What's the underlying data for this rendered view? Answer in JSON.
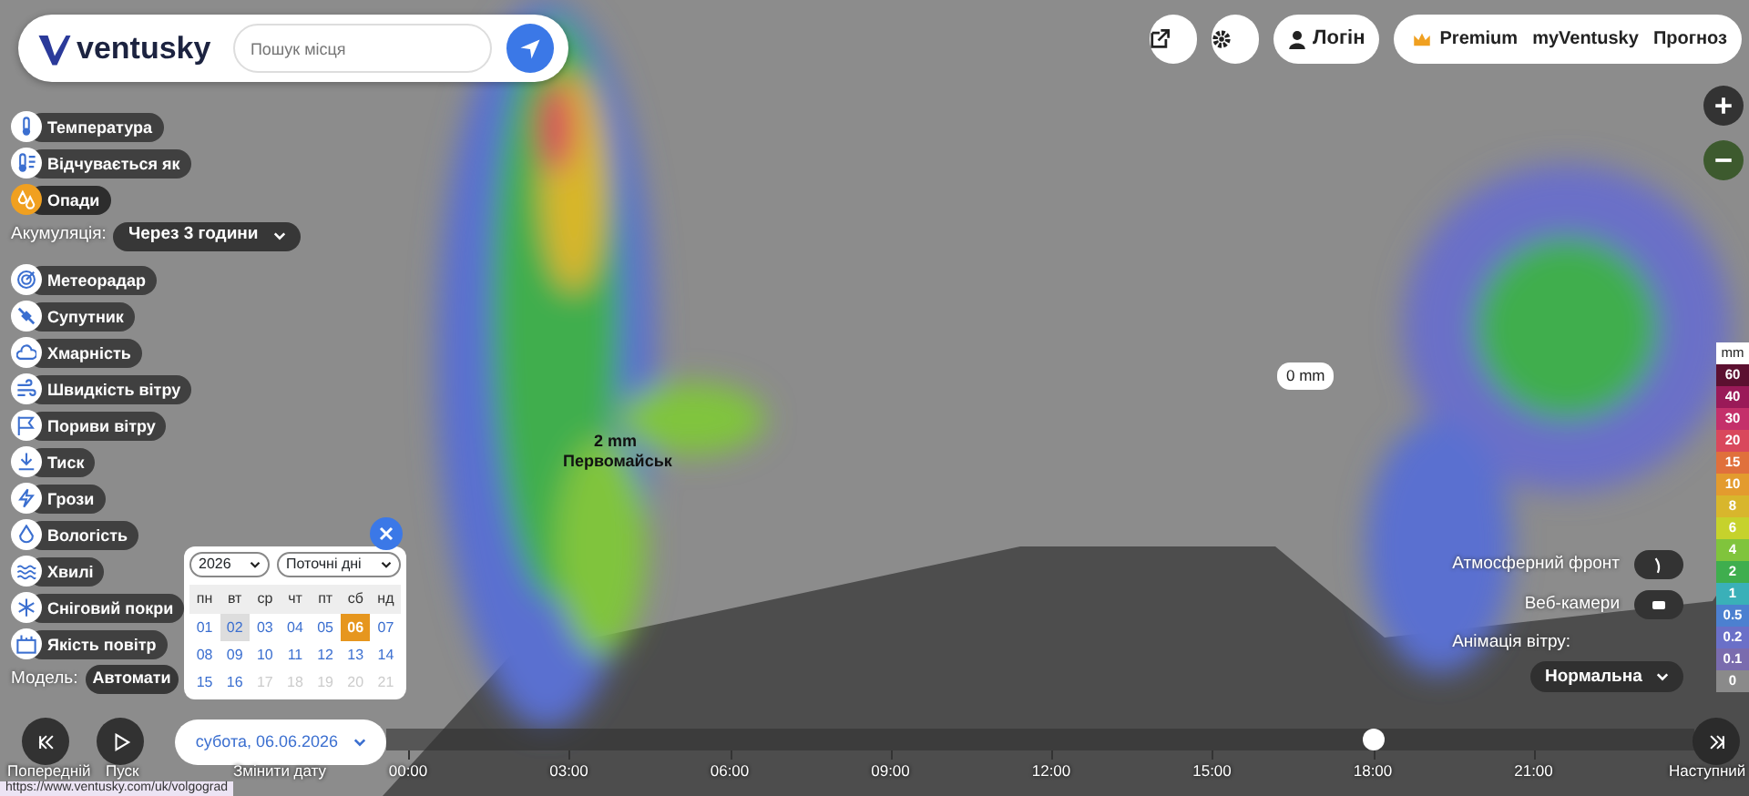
{
  "header": {
    "logo": "ventusky",
    "search": {
      "placeholder": "Пошук місця"
    }
  },
  "top_buttons": {
    "login": "Логін",
    "premium": "Premium",
    "my": "myVentusky",
    "forecast": "Прогноз"
  },
  "layers": [
    {
      "label": "Температура",
      "selected": false
    },
    {
      "label": "Відчувається як",
      "selected": false
    },
    {
      "label": "Опади",
      "selected": true
    },
    {
      "label": "Метеорадар",
      "selected": false
    },
    {
      "label": "Супутник",
      "selected": false
    },
    {
      "label": "Хмарність",
      "selected": false
    },
    {
      "label": "Швидкість вітру",
      "selected": false
    },
    {
      "label": "Пориви вітру",
      "selected": false
    },
    {
      "label": "Тиск",
      "selected": false
    },
    {
      "label": "Грози",
      "selected": false
    },
    {
      "label": "Вологість",
      "selected": false
    },
    {
      "label": "Хвилі",
      "selected": false
    },
    {
      "label": "Сніговий покри",
      "selected": false
    },
    {
      "label": "Якість повітр",
      "selected": false
    }
  ],
  "accumulation": {
    "label": "Акумуляція:",
    "value": "Через 3 години"
  },
  "model": {
    "label": "Модель:",
    "value": "Автомати"
  },
  "calendar": {
    "year": "2026",
    "range": "Поточні дні",
    "weekdays": [
      "пн",
      "вт",
      "ср",
      "чт",
      "пт",
      "сб",
      "нд"
    ],
    "days": [
      {
        "label": "01",
        "selected": false,
        "today": false,
        "disabled": false
      },
      {
        "label": "02",
        "selected": false,
        "today": true,
        "disabled": false
      },
      {
        "label": "03",
        "selected": false,
        "today": false,
        "disabled": false
      },
      {
        "label": "04",
        "selected": false,
        "today": false,
        "disabled": false
      },
      {
        "label": "05",
        "selected": false,
        "today": false,
        "disabled": false
      },
      {
        "label": "06",
        "selected": true,
        "today": false,
        "disabled": false
      },
      {
        "label": "07",
        "selected": false,
        "today": false,
        "disabled": false
      },
      {
        "label": "08",
        "selected": false,
        "today": false,
        "disabled": false
      },
      {
        "label": "09",
        "selected": false,
        "today": false,
        "disabled": false
      },
      {
        "label": "10",
        "selected": false,
        "today": false,
        "disabled": false
      },
      {
        "label": "11",
        "selected": false,
        "today": false,
        "disabled": false
      },
      {
        "label": "12",
        "selected": false,
        "today": false,
        "disabled": false
      },
      {
        "label": "13",
        "selected": false,
        "today": false,
        "disabled": false
      },
      {
        "label": "14",
        "selected": false,
        "today": false,
        "disabled": false
      },
      {
        "label": "15",
        "selected": false,
        "today": false,
        "disabled": false
      },
      {
        "label": "16",
        "selected": false,
        "today": false,
        "disabled": false
      },
      {
        "label": "17",
        "selected": false,
        "today": false,
        "disabled": true
      },
      {
        "label": "18",
        "selected": false,
        "today": false,
        "disabled": true
      },
      {
        "label": "19",
        "selected": false,
        "today": false,
        "disabled": true
      },
      {
        "label": "20",
        "selected": false,
        "today": false,
        "disabled": true
      },
      {
        "label": "21",
        "selected": false,
        "today": false,
        "disabled": true
      }
    ]
  },
  "map_labels": {
    "bubble": "0 mm",
    "amount": "2 mm",
    "city": "Первомайськ"
  },
  "right_controls": {
    "front": "Атмосферний фронт",
    "front_on": false,
    "webcams": "Веб-камери",
    "webcams_on": false,
    "wind_label": "Анімація вітру:",
    "wind_value": "Нормальна"
  },
  "legend": {
    "unit": "mm",
    "items": [
      {
        "label": "60",
        "color": "#5c1030"
      },
      {
        "label": "40",
        "color": "#9a1a58"
      },
      {
        "label": "30",
        "color": "#c4306a"
      },
      {
        "label": "20",
        "color": "#d9485c"
      },
      {
        "label": "15",
        "color": "#e0703c"
      },
      {
        "label": "10",
        "color": "#e39b2e"
      },
      {
        "label": "8",
        "color": "#d8b62c"
      },
      {
        "label": "6",
        "color": "#c6d22c"
      },
      {
        "label": "4",
        "color": "#80c43c"
      },
      {
        "label": "2",
        "color": "#3fae4e"
      },
      {
        "label": "1",
        "color": "#3ab0b8"
      },
      {
        "label": "0.5",
        "color": "#4c80d0"
      },
      {
        "label": "0.2",
        "color": "#6a70c8"
      },
      {
        "label": "0.1",
        "color": "#7a6cae"
      },
      {
        "label": "0",
        "color": "#8a8a8a"
      }
    ]
  },
  "timeline": {
    "date": "субота, 06.06.2026",
    "change_date": "Змінити дату",
    "prev": "Попередній",
    "play": "Пуск",
    "next": "Наступний",
    "level": 0.75,
    "ticks": [
      "00:00",
      "03:00",
      "06:00",
      "09:00",
      "12:00",
      "15:00",
      "18:00",
      "21:00"
    ]
  },
  "status_url": "https://www.ventusky.com/uk/volgograd"
}
